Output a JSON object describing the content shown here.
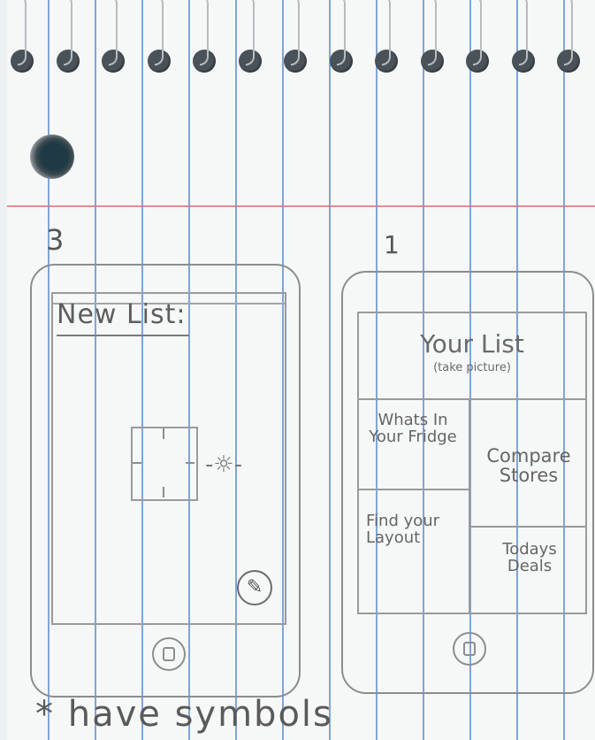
{
  "sketch_left": {
    "number": "3",
    "title": "New List:",
    "edit_icon": "pencil-icon",
    "camera_icon": "crosshair-frame-icon",
    "flash_icon": "sparkle-icon"
  },
  "sketch_right": {
    "number": "1",
    "header_title": "Your List",
    "header_sub": "(take picture)",
    "tiles": [
      {
        "label": "Whats In Your Fridge"
      },
      {
        "label": "Compare Stores"
      },
      {
        "label": "Find your Layout"
      },
      {
        "label": "Todays Deals"
      }
    ]
  },
  "footnote": "* have symbols",
  "colors": {
    "paper": "#f6f7f7",
    "rule_blue": "#7ea6d6",
    "margin_red": "#e06f7a",
    "pencil": "#6b6b6b"
  }
}
